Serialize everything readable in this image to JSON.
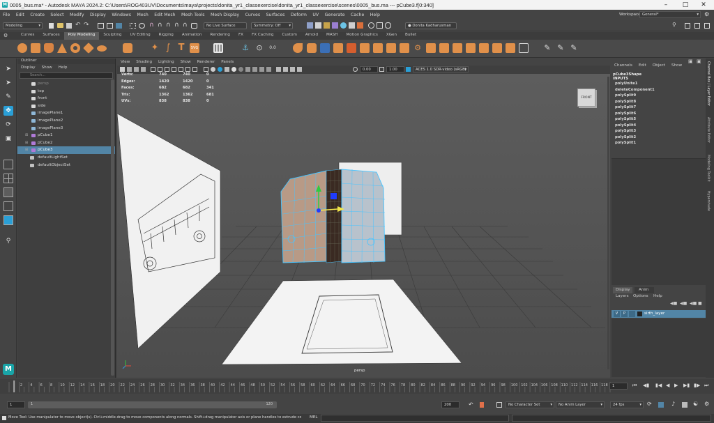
{
  "window": {
    "title": "0005_bus.ma* - Autodesk MAYA 2024.2: C:\\Users\\ROG403UV\\Documents\\maya\\projects\\donita_yr1_classexercise\\donita_yr1_classexercise\\scenes\\0005_bus.ma  ---  pCube3.f[0:340]"
  },
  "menubar": [
    "File",
    "Edit",
    "Create",
    "Select",
    "Modify",
    "Display",
    "Windows",
    "Mesh",
    "Edit Mesh",
    "Mesh Tools",
    "Mesh Display",
    "Curves",
    "Surfaces",
    "Deform",
    "UV",
    "Generate",
    "Cache",
    "Help"
  ],
  "workspace": {
    "label": "Workspace :",
    "value": "General*"
  },
  "statusline": {
    "mode": "Modeling",
    "live_surface": "No Live Surface",
    "symmetry": "Symmetry: Off",
    "user": "Donita Kadharusman"
  },
  "shelf_tabs": [
    "Curves",
    "Surfaces",
    "Poly Modeling",
    "Sculpting",
    "UV Editing",
    "Rigging",
    "Animation",
    "Rendering",
    "FX",
    "FX Caching",
    "Custom",
    "Arnold",
    "MASH",
    "Motion Graphics",
    "XGen",
    "Bullet"
  ],
  "active_shelf": "Poly Modeling",
  "outliner": {
    "title": "Outliner",
    "menu": [
      "Display",
      "Show",
      "Help"
    ],
    "search_placeholder": "Search...",
    "items": [
      {
        "label": "persp",
        "type": "camera",
        "indent": 1,
        "dim": true
      },
      {
        "label": "top",
        "type": "camera",
        "indent": 1
      },
      {
        "label": "front",
        "type": "camera",
        "indent": 1
      },
      {
        "label": "side",
        "type": "camera",
        "indent": 1
      },
      {
        "label": "imagePlane1",
        "type": "image",
        "indent": 1
      },
      {
        "label": "imagePlane2",
        "type": "image",
        "indent": 1
      },
      {
        "label": "imagePlane3",
        "type": "image",
        "indent": 1
      },
      {
        "label": "pCube1",
        "type": "mesh",
        "indent": 0
      },
      {
        "label": "pCube2",
        "type": "mesh",
        "indent": 0
      },
      {
        "label": "pCube3",
        "type": "mesh",
        "indent": 0,
        "selected": true
      },
      {
        "label": "defaultLightSet",
        "type": "set",
        "indent": 0
      },
      {
        "label": "defaultObjectSet",
        "type": "set",
        "indent": 0
      }
    ]
  },
  "viewport": {
    "menu": [
      "View",
      "Shading",
      "Lighting",
      "Show",
      "Renderer",
      "Panels"
    ],
    "exposure": "0.00",
    "gamma": "1.00",
    "colorspace": "ACES 1.0 SDR-video (sRGB)",
    "camera_label": "persp",
    "viewcube_label": "FRONT",
    "hud": [
      {
        "label": "Verts:",
        "v1": "740",
        "v2": "740",
        "v3": "0"
      },
      {
        "label": "Edges:",
        "v1": "1420",
        "v2": "1420",
        "v3": "0"
      },
      {
        "label": "Faces:",
        "v1": "682",
        "v2": "682",
        "v3": "341"
      },
      {
        "label": "Tris:",
        "v1": "1362",
        "v2": "1362",
        "v3": "681"
      },
      {
        "label": "UVs:",
        "v1": "838",
        "v2": "838",
        "v3": "0"
      }
    ]
  },
  "channel_box": {
    "menu": [
      "Channels",
      "Edit",
      "Object",
      "Show"
    ],
    "shape": "pCube3Shape",
    "inputs_label": "INPUTS",
    "inputs": [
      "polyUnite1",
      "deleteComponent1",
      "polySplit9",
      "polySplit8",
      "polySplit7",
      "polySplit6",
      "polySplit5",
      "polySplit4",
      "polySplit3",
      "polySplit2",
      "polySplit1"
    ]
  },
  "layers": {
    "tabs": [
      "Display",
      "Anim"
    ],
    "menu": [
      "Layers",
      "Options",
      "Help"
    ],
    "layer": {
      "v": "V",
      "p": "P",
      "name": "sirth_layer"
    }
  },
  "side_tabs": [
    "Channel Box / Layer Editor",
    "Attribute Editor",
    "Modeling Toolkit",
    "Hypershade"
  ],
  "timeline": {
    "ticks": [
      "2",
      "4",
      "6",
      "8",
      "10",
      "12",
      "14",
      "16",
      "18",
      "20",
      "22",
      "24",
      "26",
      "28",
      "30",
      "32",
      "34",
      "36",
      "38",
      "40",
      "42",
      "44",
      "46",
      "48",
      "50",
      "52",
      "54",
      "56",
      "58",
      "60",
      "62",
      "64",
      "66",
      "68",
      "70",
      "72",
      "74",
      "76",
      "78",
      "80",
      "82",
      "84",
      "86",
      "88",
      "90",
      "92",
      "94",
      "96",
      "98",
      "100",
      "102",
      "104",
      "106",
      "108",
      "110",
      "112",
      "114",
      "116",
      "118",
      "120"
    ],
    "current_frame": "1"
  },
  "range": {
    "start": "1",
    "inner_start": "1",
    "inner_end": "120",
    "end": "120",
    "max": "200",
    "character_set": "No Character Set",
    "anim_layer": "No Anim Layer",
    "fps": "24 fps"
  },
  "helpline": {
    "lang": "MEL",
    "text": "Move Tool: Use manipulator to move object(s). Ctrl+middle-drag to move components along normals. Shift+drag manipulator axis or plane handles to extrude components or"
  },
  "colors": {
    "selection": "#5285a6",
    "wire": "#48c4ff",
    "accent": "#2a9fd6",
    "maya_logo": "#19a5a8"
  }
}
